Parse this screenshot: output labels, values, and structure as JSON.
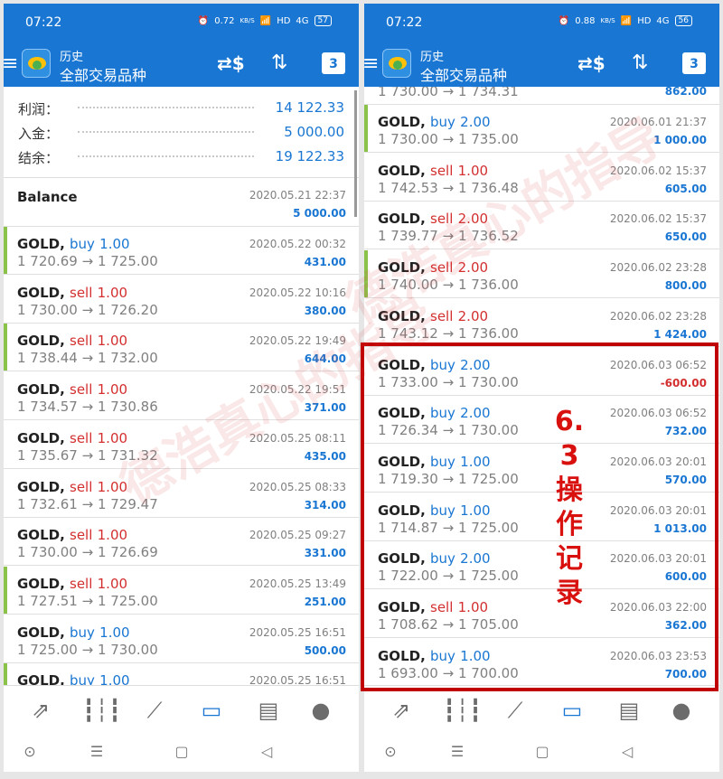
{
  "status_bar": {
    "time": "07:22",
    "left_speed": "0.72",
    "right_speed": "0.88",
    "speed_unit": "KB/S",
    "network": "HD",
    "signal": "4G",
    "left_battery": "57",
    "right_battery": "56"
  },
  "header": {
    "title": "历史",
    "subtitle": "全部交易品种"
  },
  "summary": {
    "profit_label": "利润：",
    "profit_value": "14 122.33",
    "deposit_label": "入金：",
    "deposit_value": "5 000.00",
    "balance_label": "结余：",
    "balance_value": "19 122.33"
  },
  "balance_entry": {
    "title": "Balance",
    "time": "2020.05.21 22:37",
    "amount": "5 000.00"
  },
  "left_trades": [
    {
      "symbol": "GOLD,",
      "side": "buy",
      "volume": "1.00",
      "open": "1 720.69",
      "arrow": "→",
      "close": "1 725.00",
      "time": "2020.05.22 00:32",
      "profit": "431.00"
    },
    {
      "symbol": "GOLD,",
      "side": "sell",
      "volume": "1.00",
      "open": "1 730.00",
      "arrow": "→",
      "close": "1 726.20",
      "time": "2020.05.22 10:16",
      "profit": "380.00"
    },
    {
      "symbol": "GOLD,",
      "side": "sell",
      "volume": "1.00",
      "open": "1 738.44",
      "arrow": "→",
      "close": "1 732.00",
      "time": "2020.05.22 19:49",
      "profit": "644.00"
    },
    {
      "symbol": "GOLD,",
      "side": "sell",
      "volume": "1.00",
      "open": "1 734.57",
      "arrow": "→",
      "close": "1 730.86",
      "time": "2020.05.22 19:51",
      "profit": "371.00"
    },
    {
      "symbol": "GOLD,",
      "side": "sell",
      "volume": "1.00",
      "open": "1 735.67",
      "arrow": "→",
      "close": "1 731.32",
      "time": "2020.05.25 08:11",
      "profit": "435.00"
    },
    {
      "symbol": "GOLD,",
      "side": "sell",
      "volume": "1.00",
      "open": "1 732.61",
      "arrow": "→",
      "close": "1 729.47",
      "time": "2020.05.25 08:33",
      "profit": "314.00"
    },
    {
      "symbol": "GOLD,",
      "side": "sell",
      "volume": "1.00",
      "open": "1 730.00",
      "arrow": "→",
      "close": "1 726.69",
      "time": "2020.05.25 09:27",
      "profit": "331.00"
    },
    {
      "symbol": "GOLD,",
      "side": "sell",
      "volume": "1.00",
      "open": "1 727.51",
      "arrow": "→",
      "close": "1 725.00",
      "time": "2020.05.25 13:49",
      "profit": "251.00"
    },
    {
      "symbol": "GOLD,",
      "side": "buy",
      "volume": "1.00",
      "open": "1 725.00",
      "arrow": "→",
      "close": "1 730.00",
      "time": "2020.05.25 16:51",
      "profit": "500.00"
    },
    {
      "symbol": "GOLD,",
      "side": "buy",
      "volume": "1.00",
      "open": "",
      "arrow": "",
      "close": "",
      "time": "2020.05.25 16:51",
      "profit": ""
    }
  ],
  "right_partial": {
    "prices": "1 730.00 → 1 734.31",
    "profit": "862.00"
  },
  "right_trades": [
    {
      "symbol": "GOLD,",
      "side": "buy",
      "volume": "2.00",
      "open": "1 730.00",
      "arrow": "→",
      "close": "1 735.00",
      "time": "2020.06.01 21:37",
      "profit": "1 000.00"
    },
    {
      "symbol": "GOLD,",
      "side": "sell",
      "volume": "1.00",
      "open": "1 742.53",
      "arrow": "→",
      "close": "1 736.48",
      "time": "2020.06.02 15:37",
      "profit": "605.00"
    },
    {
      "symbol": "GOLD,",
      "side": "sell",
      "volume": "2.00",
      "open": "1 739.77",
      "arrow": "→",
      "close": "1 736.52",
      "time": "2020.06.02 15:37",
      "profit": "650.00"
    },
    {
      "symbol": "GOLD,",
      "side": "sell",
      "volume": "2.00",
      "open": "1 740.00",
      "arrow": "→",
      "close": "1 736.00",
      "time": "2020.06.02 23:28",
      "profit": "800.00"
    },
    {
      "symbol": "GOLD,",
      "side": "sell",
      "volume": "2.00",
      "open": "1 743.12",
      "arrow": "→",
      "close": "1 736.00",
      "time": "2020.06.02 23:28",
      "profit": "1 424.00"
    },
    {
      "symbol": "GOLD,",
      "side": "buy",
      "volume": "2.00",
      "open": "1 733.00",
      "arrow": "→",
      "close": "1 730.00",
      "time": "2020.06.03 06:52",
      "profit": "-600.00"
    },
    {
      "symbol": "GOLD,",
      "side": "buy",
      "volume": "2.00",
      "open": "1 726.34",
      "arrow": "→",
      "close": "1 730.00",
      "time": "2020.06.03 06:52",
      "profit": "732.00"
    },
    {
      "symbol": "GOLD,",
      "side": "buy",
      "volume": "1.00",
      "open": "1 719.30",
      "arrow": "→",
      "close": "1 725.00",
      "time": "2020.06.03 20:01",
      "profit": "570.00"
    },
    {
      "symbol": "GOLD,",
      "side": "buy",
      "volume": "1.00",
      "open": "1 714.87",
      "arrow": "→",
      "close": "1 725.00",
      "time": "2020.06.03 20:01",
      "profit": "1 013.00"
    },
    {
      "symbol": "GOLD,",
      "side": "buy",
      "volume": "2.00",
      "open": "1 722.00",
      "arrow": "→",
      "close": "1 725.00",
      "time": "2020.06.03 20:01",
      "profit": "600.00"
    },
    {
      "symbol": "GOLD,",
      "side": "sell",
      "volume": "1.00",
      "open": "1 708.62",
      "arrow": "→",
      "close": "1 705.00",
      "time": "2020.06.03 22:00",
      "profit": "362.00"
    },
    {
      "symbol": "GOLD,",
      "side": "buy",
      "volume": "1.00",
      "open": "1 693.00",
      "arrow": "→",
      "close": "1 700.00",
      "time": "2020.06.03 23:53",
      "profit": "700.00"
    }
  ],
  "annotation": {
    "text": "6.3操作记录"
  },
  "watermark": {
    "text": "德浩真心的指导"
  },
  "colors": {
    "primary": "#1976d2",
    "buy": "#1976d2",
    "sell": "#d32f2f",
    "accent_bar": "#8bc34a",
    "annotation": "#c00000"
  },
  "icons": {
    "header": [
      "menu-icon",
      "app-logo",
      "currency-exchange-icon",
      "sort-icon",
      "calendar-icon"
    ],
    "calendar_day": "3",
    "bottom_nav": [
      "trade-icon",
      "candlestick-chart-icon",
      "line-chart-icon",
      "history-inbox-icon",
      "news-icon",
      "chat-icon"
    ],
    "system_nav": [
      "circle-nav-icon",
      "menu-nav-icon",
      "home-square-icon",
      "back-triangle-icon"
    ]
  }
}
